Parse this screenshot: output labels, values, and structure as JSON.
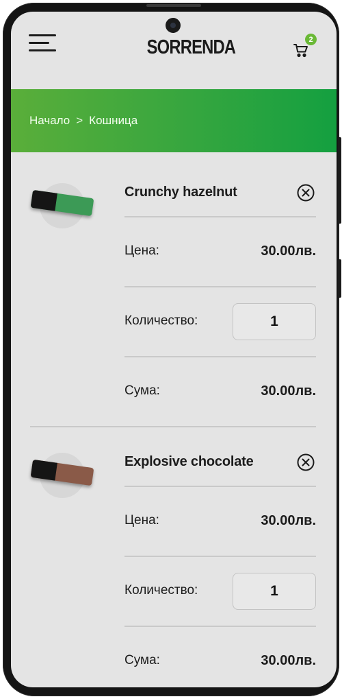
{
  "header": {
    "logo": "SORRENDA",
    "cart_count": "2"
  },
  "breadcrumb": {
    "home": "Начало",
    "separator": ">",
    "current": "Кошница"
  },
  "labels": {
    "price": "Цена:",
    "quantity": "Количество:",
    "total": "Сума:"
  },
  "items": [
    {
      "name": "Crunchy hazelnut",
      "price": "30.00лв.",
      "quantity": "1",
      "total": "30.00лв.",
      "wrapper_color": "#3c9a56"
    },
    {
      "name": "Explosive chocolate",
      "price": "30.00лв.",
      "quantity": "1",
      "total": "30.00лв.",
      "wrapper_color": "#8a5a48"
    }
  ],
  "colors": {
    "accent": "#5aae3a",
    "badge": "#6ab936",
    "screen_bg": "#e4e4e4"
  },
  "icons": {
    "menu": "hamburger-icon",
    "cart": "cart-icon",
    "remove": "close-circle-icon",
    "breadcrumb": "chevron-right-icon"
  }
}
